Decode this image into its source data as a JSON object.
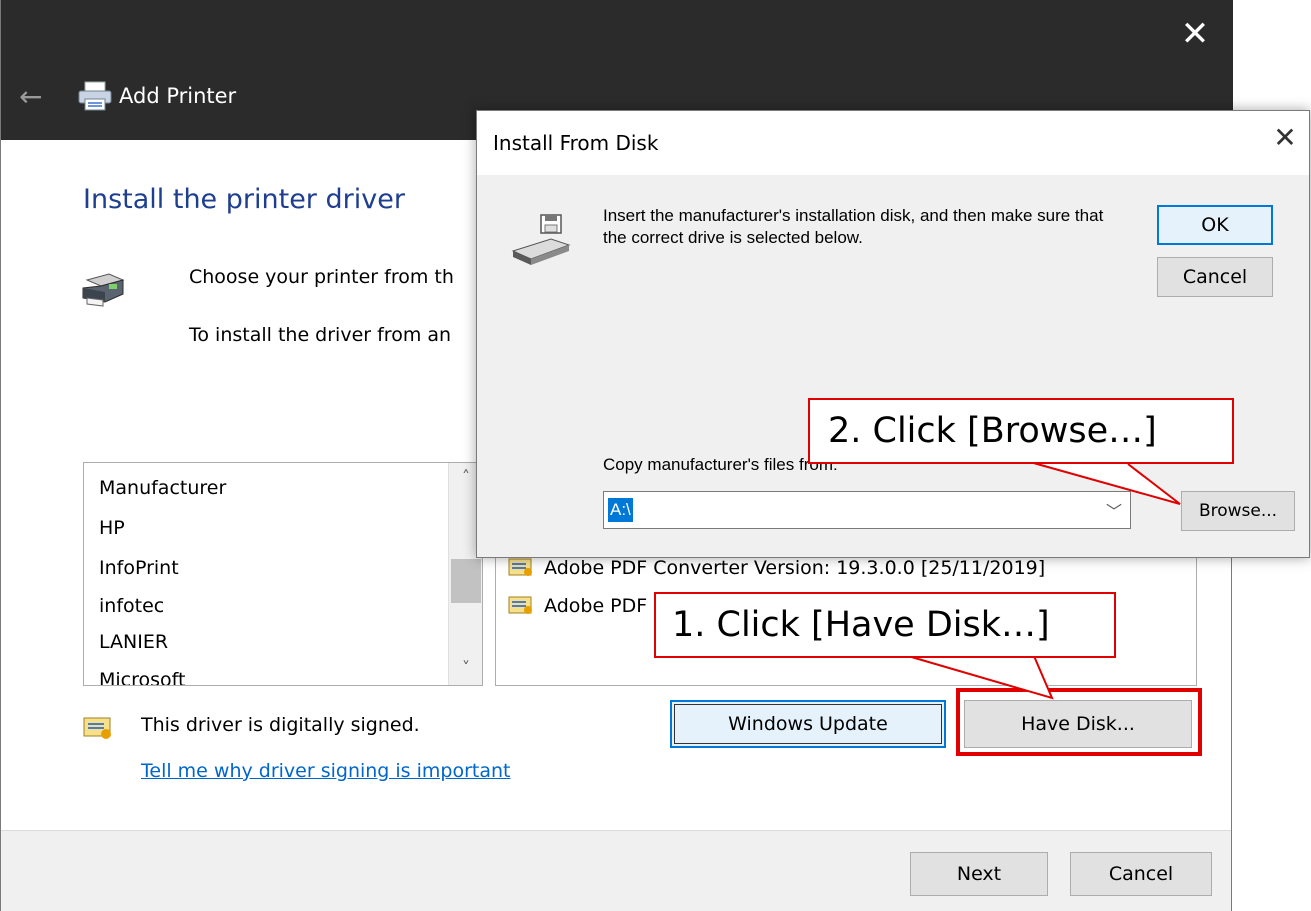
{
  "main_window": {
    "title": "Add Printer",
    "close_glyph": "✕",
    "back_glyph": "←",
    "heading": "Install the printer driver",
    "desc_line1": "Choose your printer from th",
    "desc_line2": "To install the driver from an",
    "manufacturer_list": {
      "items": [
        "Manufacturer",
        "HP",
        "InfoPrint",
        "infotec",
        "LANIER",
        "Microsoft"
      ]
    },
    "printer_list": {
      "items": [
        "Adobe PDF Converter Version: 19.3.0.0 [25/11/2019]",
        "Adobe PDF"
      ]
    },
    "buttons": {
      "windows_update": "Windows Update",
      "have_disk": "Have Disk...",
      "next": "Next",
      "cancel": "Cancel"
    },
    "signed_text": "This driver is digitally signed.",
    "signed_link": "Tell me why driver signing is important"
  },
  "dialog": {
    "title": "Install From Disk",
    "close_glyph": "✕",
    "message": "Insert the manufacturer's installation disk, and then make sure that the correct drive is selected below.",
    "ok_label": "OK",
    "cancel_label": "Cancel",
    "copy_label": "Copy manufacturer's files from:",
    "copy_value": "A:\\",
    "browse_label": "Browse..."
  },
  "annotations": {
    "step1": "1. Click [Have Disk…]",
    "step2": "2. Click [Browse…]",
    "highlight_color": "#e00000"
  },
  "colors": {
    "titlebar": "#2b2b2b",
    "heading": "#1e3e8f",
    "link": "#0066cc",
    "accent": "#0078d7"
  }
}
